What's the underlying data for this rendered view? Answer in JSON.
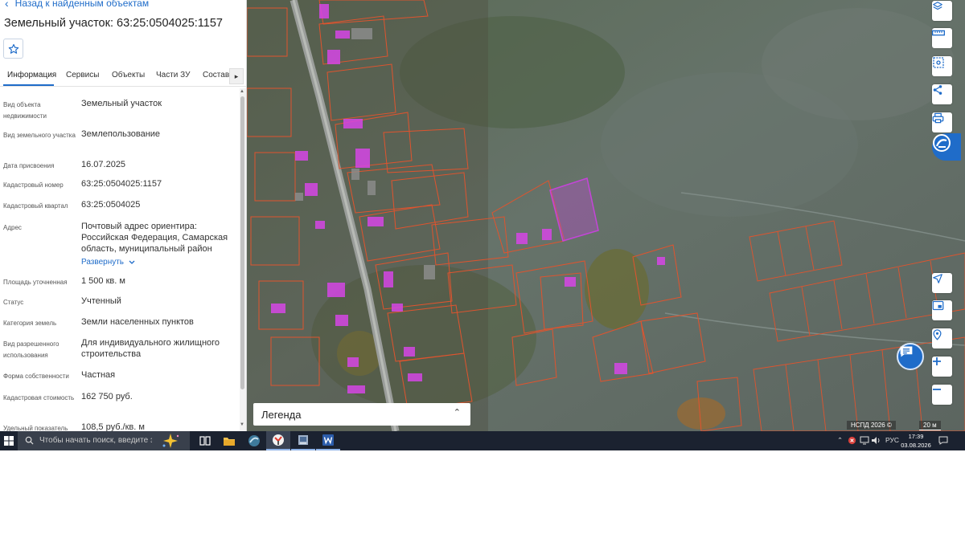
{
  "panel": {
    "back_label": "Назад к найденным объектам",
    "title": "Земельный участок: 63:25:0504025:1157",
    "tabs": [
      {
        "label": "Информация"
      },
      {
        "label": "Сервисы"
      },
      {
        "label": "Объекты"
      },
      {
        "label": "Части ЗУ"
      },
      {
        "label": "Состав"
      }
    ],
    "attributes": [
      {
        "label": "Вид объекта недвижимости",
        "value": "Земельный участок"
      },
      {
        "label": "Вид земельного участка",
        "value": "Землепользование"
      },
      {
        "label": "Дата присвоения",
        "value": "16.07.2025"
      },
      {
        "label": "Кадастровый номер",
        "value": "63:25:0504025:1157"
      },
      {
        "label": "Кадастровый квартал",
        "value": "63:25:0504025"
      },
      {
        "label": "Адрес",
        "value": "Почтовый адрес ориентира: Российская Федерация, Самарская область, муниципальный район"
      },
      {
        "label": "Площадь уточненная",
        "value": "1 500 кв. м"
      },
      {
        "label": "Статус",
        "value": "Учтенный"
      },
      {
        "label": "Категория земель",
        "value": "Земли населенных пунктов"
      },
      {
        "label": "Вид разрешенного использования",
        "value": "Для индивидуального жилищного строительства"
      },
      {
        "label": "Форма собственности",
        "value": "Частная"
      },
      {
        "label": "Кадастровая стоимость",
        "value": "162 750 руб."
      },
      {
        "label": "Удельный показатель",
        "value": "108,5 руб./кв. м"
      }
    ],
    "expand_label": "Развернуть"
  },
  "map": {
    "legend_label": "Легенда",
    "attribution": "НСПД 2026 ©",
    "scale_label": "20 м",
    "colors": {
      "parcel": "#e0542e",
      "selected": "#c445d8",
      "building": "#d646e6",
      "brand": "#1f6cc9"
    }
  },
  "taskbar": {
    "search_placeholder": "Чтобы начать поиск, введите здесь запрос",
    "language": "РУС",
    "time": "17:39",
    "date": "03.08.2026"
  }
}
